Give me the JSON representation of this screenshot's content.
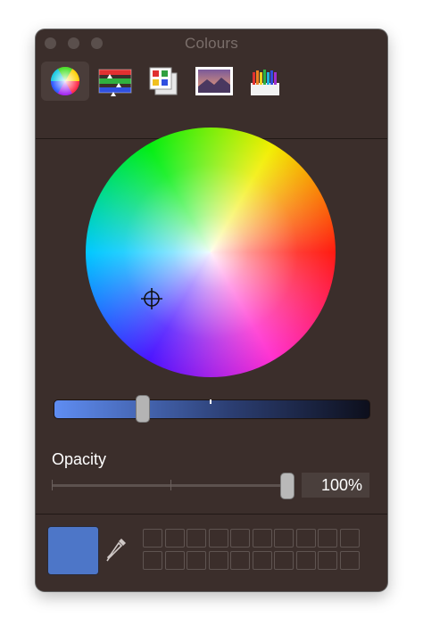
{
  "window": {
    "title": "Colours",
    "traffic_lights": [
      "close-button",
      "minimize-button",
      "zoom-button"
    ]
  },
  "toolbar": {
    "tabs": [
      {
        "name": "colour-wheel",
        "icon": "color-wheel-icon",
        "selected": true
      },
      {
        "name": "colour-sliders",
        "icon": "sliders-icon",
        "selected": false
      },
      {
        "name": "colour-palettes",
        "icon": "palettes-icon",
        "selected": false
      },
      {
        "name": "image-palettes",
        "icon": "image-palette-icon",
        "selected": false
      },
      {
        "name": "pencils",
        "icon": "pencils-icon",
        "selected": false
      }
    ]
  },
  "wheel": {
    "selected_colour": "#4D76C8"
  },
  "brightness": {
    "level": 0.28
  },
  "opacity": {
    "label": "Opacity",
    "value_text": "100%",
    "value": 1.0
  },
  "swatch": {
    "current_colour": "#4D76C8",
    "empty_slots": 20
  },
  "colors": {
    "window_bg": "#3B2E2B",
    "accent_selected": "#4D76C8"
  }
}
